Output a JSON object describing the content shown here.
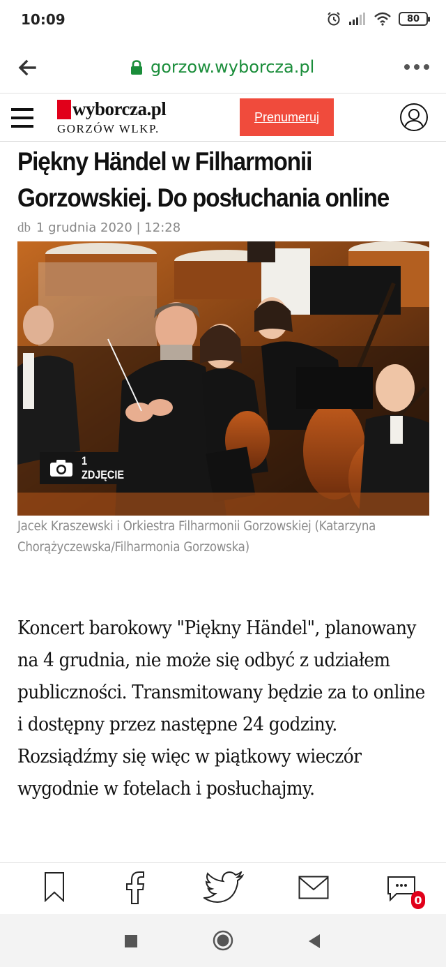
{
  "status_bar": {
    "time": "10:09",
    "battery_level": "80",
    "icons": [
      "alarm-icon",
      "signal-icon",
      "wifi-icon",
      "battery-icon"
    ]
  },
  "browser": {
    "url": "gorzow.wyborcza.pl",
    "icons": [
      "back-arrow-icon",
      "lock-icon",
      "more-icon"
    ]
  },
  "site_header": {
    "logo_title": "wyborcza.pl",
    "logo_subtitle": "GORZÓW WLKP.",
    "subscribe_label": "Prenumeruj",
    "brand_color": "#e1001a",
    "subscribe_color": "#f04b3c"
  },
  "article": {
    "headline": "Piękny Händel w Filharmonii Gorzowskiej. Do posłuchania online",
    "author": "db",
    "date": "1 grudnia 2020 | 12:28",
    "photo_badge": "1 ZDJĘCIE",
    "caption": "Jacek Kraszewski i Orkiestra Filharmonii Gorzowskiej (Katarzyna Chorążyczewska/Filharmonia Gorzowska)",
    "body": "Koncert barokowy \"Piękny Händel\", planowany na 4 grudnia, nie może się odbyć z udziałem publiczności. Transmitowany będzie za to online i dostępny przez następne 24 godziny. Rozsiądźmy się więc w piątkowy wieczór wygodnie w fotelach i posłuchajmy."
  },
  "share_bar": {
    "items": [
      "bookmark-icon",
      "facebook-icon",
      "twitter-icon",
      "mail-icon",
      "comment-icon"
    ],
    "comment_count": "0"
  },
  "nav_bar": {
    "items": [
      "recent-apps-icon",
      "home-icon",
      "back-icon"
    ]
  }
}
